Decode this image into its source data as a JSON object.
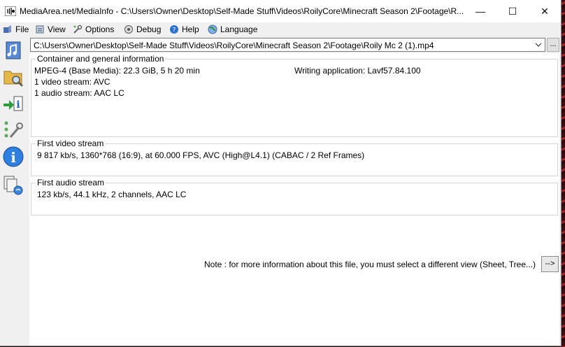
{
  "window": {
    "title": "MediaArea.net/MediaInfo - C:\\Users\\Owner\\Desktop\\Self-Made Stuff\\Videos\\RoilyCore\\Minecraft Season 2\\Footage\\R...",
    "minimize": "—",
    "maximize": "☐",
    "close": "✕"
  },
  "menu": {
    "file": "File",
    "view": "View",
    "options": "Options",
    "debug": "Debug",
    "help": "Help",
    "language": "Language"
  },
  "sidebar": {
    "icons": [
      "open-file-icon",
      "open-folder-icon",
      "export-icon",
      "preferences-icon",
      "about-icon",
      "knowledge-base-icon"
    ]
  },
  "file_select": {
    "value": "C:\\Users\\Owner\\Desktop\\Self-Made Stuff\\Videos\\RoilyCore\\Minecraft Season 2\\Footage\\Roily Mc 2 (1).mp4",
    "browse_label": "..."
  },
  "general": {
    "title": "Container and general information",
    "format": "MPEG-4 (Base Media): 22.3 GiB, 5 h 20 min",
    "writing_app": "Writing application: Lavf57.84.100",
    "video_count": "1 video stream: AVC",
    "audio_count": "1 audio stream: AAC LC"
  },
  "video": {
    "title": "First video stream",
    "details": "9 817 kb/s, 1360*768 (16:9), at 60.000 FPS, AVC (High@L4.1) (CABAC / 2 Ref Frames)"
  },
  "audio": {
    "title": "First audio stream",
    "details": "123 kb/s, 44.1 kHz, 2 channels, AAC LC"
  },
  "note": {
    "text": "Note : for more information about this file, you must select a different view (Sheet, Tree...)",
    "button": "-->"
  }
}
